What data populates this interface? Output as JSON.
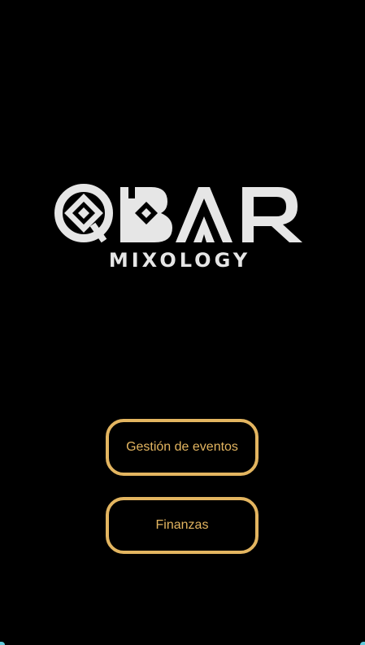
{
  "logo": {
    "title": "QBAR",
    "subtitle": "MIXOLOGY",
    "color": "#e6e6e6"
  },
  "menu": {
    "events_label": "Gestión de eventos",
    "finance_label": "Finanzas"
  },
  "colors": {
    "background": "#000000",
    "accent": "#e3b560"
  }
}
